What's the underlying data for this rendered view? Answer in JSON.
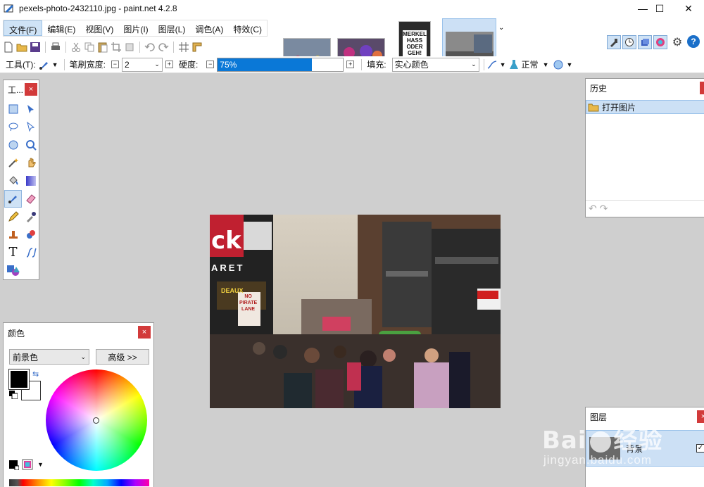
{
  "window": {
    "title": "pexels-photo-2432110.jpg - paint.net 4.2.8",
    "minimize_glyph": "—",
    "maximize_glyph": "☐",
    "close_glyph": "✕"
  },
  "menu": {
    "items": [
      "文件(F)",
      "编辑(E)",
      "视图(V)",
      "图片(I)",
      "图层(L)",
      "调色(A)",
      "特效(C)"
    ]
  },
  "thumbnails": {
    "sign_text": "MERKEL\nHASS\nODER\nGEH!"
  },
  "options": {
    "tool_label": "工具(T):",
    "brush_width_label": "笔刷宽度:",
    "brush_width_value": "2",
    "hardness_label": "硬度:",
    "hardness_value": "75%",
    "hardness_percent": 75,
    "fill_label": "填充:",
    "fill_value": "实心颜色",
    "blend_value": "正常"
  },
  "tools_panel": {
    "title": "工...",
    "close": "×"
  },
  "history_panel": {
    "title": "历史",
    "close": "×",
    "items": [
      "打开图片"
    ]
  },
  "colors_panel": {
    "title": "颜色",
    "close": "×",
    "mode_value": "前景色",
    "advanced_label": "高级 >>",
    "primary_color": "#000000",
    "secondary_color": "#ffffff"
  },
  "layers_panel": {
    "title": "图层",
    "close": "×",
    "layer_name": "背景"
  },
  "canvas_signs": {
    "brand": "ck",
    "aret": "ARET",
    "deaux": "DEAUX",
    "pirate": "NO\nPIRATE\nLANE"
  },
  "watermark": {
    "brand_text": "Bai",
    "brand_text2": "经验",
    "url_text": "jingyan.baidu.com"
  },
  "colors": {
    "accent": "#0a78d7",
    "selection_bg": "#cce0f5",
    "panel_close": "#d23a3a"
  }
}
